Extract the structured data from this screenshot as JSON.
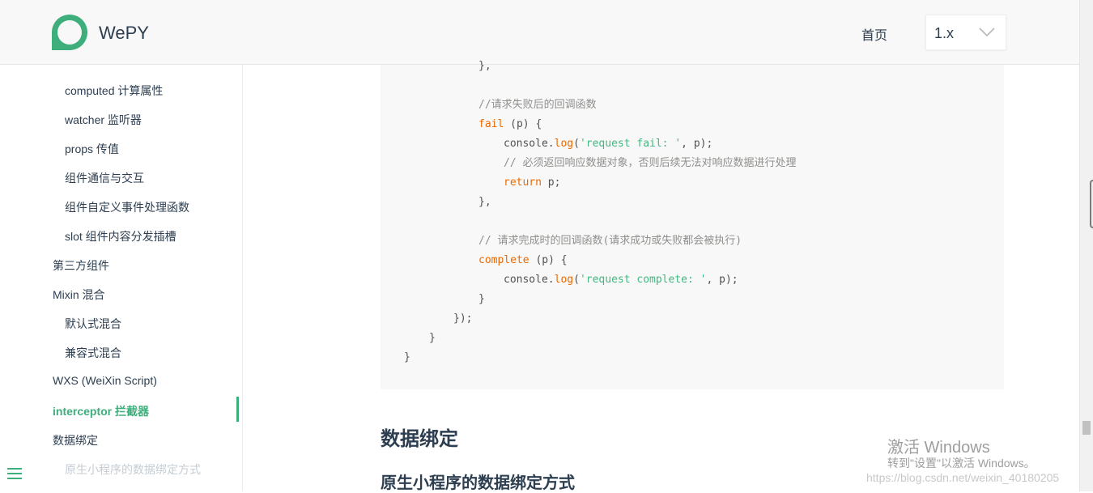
{
  "header": {
    "logo_text": "WePY",
    "nav_home": "首页",
    "version": "1.x",
    "brand_color": "#3eaf7c",
    "logo_icon": "ring-logo-icon",
    "chevron_icon": "chevron-down-icon"
  },
  "sidebar": {
    "items": [
      {
        "label": "computed 计算属性"
      },
      {
        "label": "watcher 监听器"
      },
      {
        "label": "props 传值"
      },
      {
        "label": "组件通信与交互"
      },
      {
        "label": "组件自定义事件处理函数"
      },
      {
        "label": "slot 组件内容分发插槽"
      },
      {
        "label": "第三方组件"
      },
      {
        "label": "Mixin 混合"
      },
      {
        "label": "默认式混合"
      },
      {
        "label": "兼容式混合"
      },
      {
        "label": "WXS (WeiXin Script)"
      },
      {
        "label": "interceptor 拦截器"
      },
      {
        "label": "数据绑定"
      },
      {
        "label": "原生小程序的数据绑定方式"
      }
    ],
    "menu_icon": "hamburger-menu-icon"
  },
  "code": {
    "lines": [
      {
        "t": "},"
      },
      {
        "t": ""
      },
      {
        "cm": "//请求失败后的回调函数"
      },
      {
        "kw": "fail",
        "rest": " (p) {"
      },
      {
        "pre": "console.",
        "fn": "log",
        "open": "(",
        "str": "'request fail: '",
        "rest": ", p);"
      },
      {
        "cm": "// 必须返回响应数据对象，否则后续无法对响应数据进行处理"
      },
      {
        "kw": "return",
        "rest": " p;"
      },
      {
        "t": "},"
      },
      {
        "t": ""
      },
      {
        "cm": "// 请求完成时的回调函数(请求成功或失败都会被执行)"
      },
      {
        "kw": "complete",
        "rest": " (p) {"
      },
      {
        "pre": "console.",
        "fn": "log",
        "open": "(",
        "str": "'request complete: '",
        "rest": ", p);"
      },
      {
        "t": "}"
      },
      {
        "t": "});"
      },
      {
        "t": "}"
      },
      {
        "t": "}"
      }
    ]
  },
  "content": {
    "h2": "数据绑定",
    "h3": "原生小程序的数据绑定方式"
  },
  "watermark": {
    "title": "激活 Windows",
    "sub": "转到\"设置\"以激活 Windows。",
    "url": "https://blog.csdn.net/weixin_40180205"
  }
}
